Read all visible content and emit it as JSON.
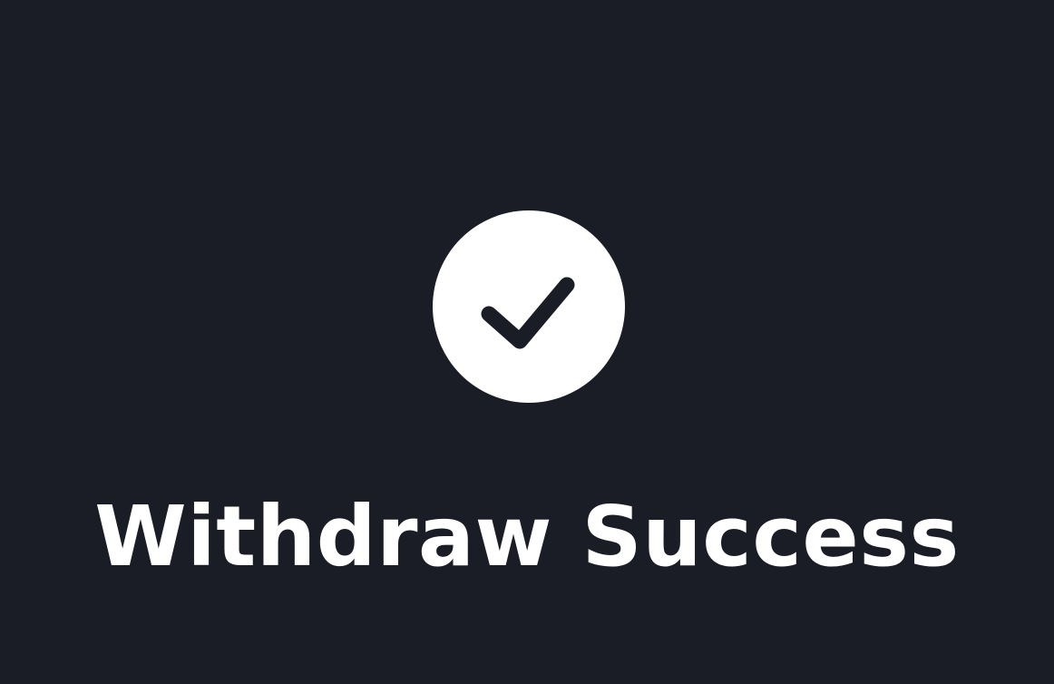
{
  "colors": {
    "background": "#1a1d26",
    "icon_background": "#ffffff",
    "check_mark": "#1a1d26",
    "text": "#ffffff"
  },
  "icon": {
    "name": "check-circle-icon"
  },
  "message": {
    "text": "Withdraw Success"
  }
}
